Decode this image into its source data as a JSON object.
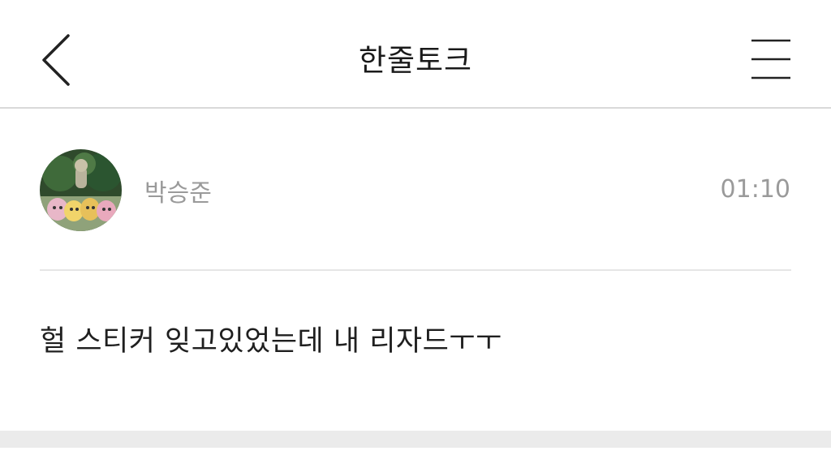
{
  "header": {
    "title": "한줄토크",
    "back_icon": "chevron-left-icon",
    "menu_icon": "hamburger-menu-icon"
  },
  "post": {
    "author": "박승준",
    "time": "01:10",
    "avatar_icon": "avatar-image",
    "message": "헐 스티커 잊고있었는데 내 리자드ㅜㅜ"
  },
  "colors": {
    "header_divider": "#d9d9d9",
    "muted_text": "#9a9a9a",
    "body_text": "#1f1f1f",
    "bottom_band": "#ebebeb"
  }
}
